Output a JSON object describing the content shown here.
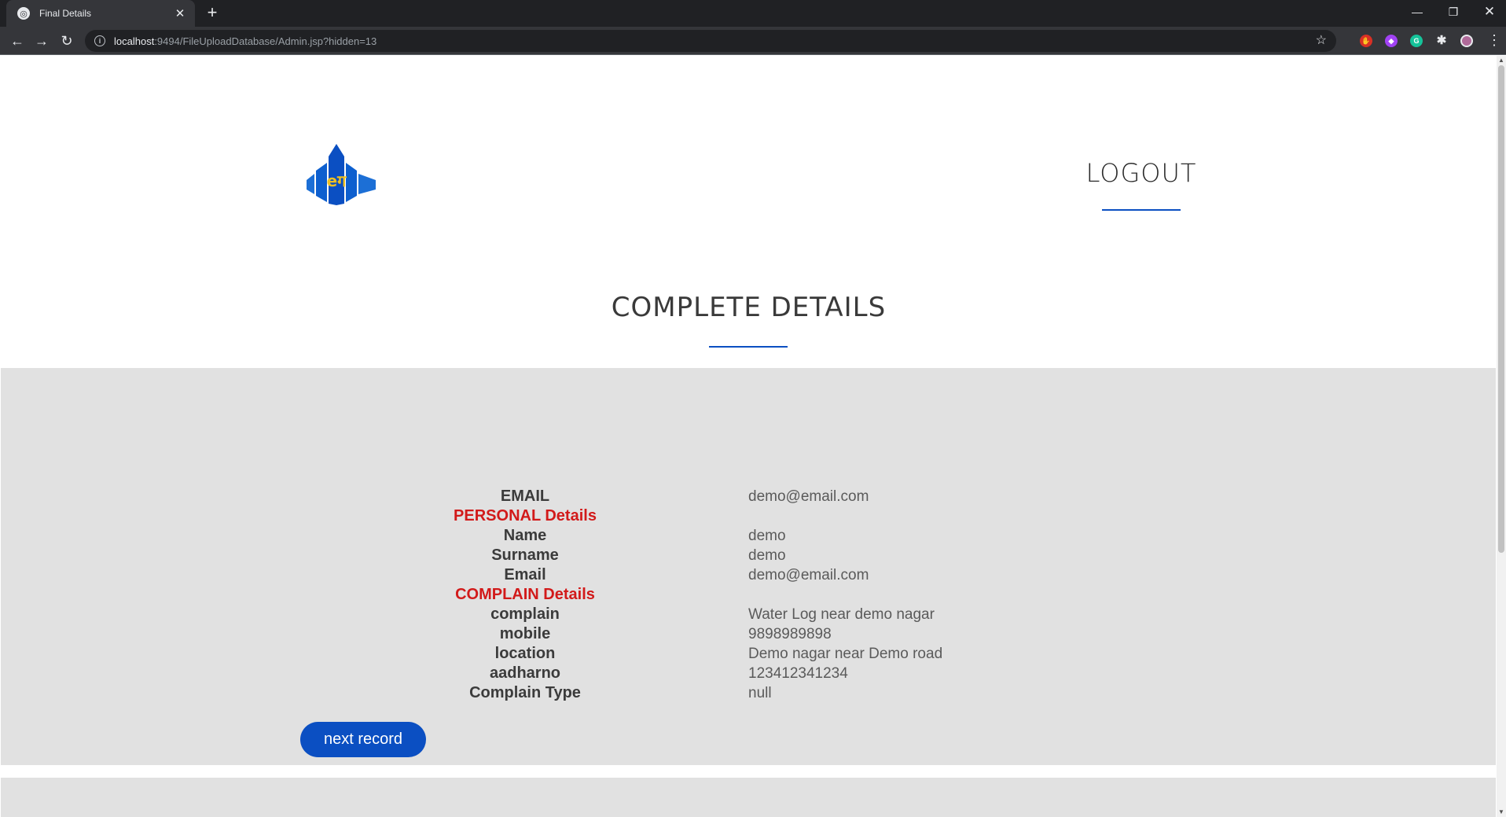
{
  "browser": {
    "tab_title": "Final Details",
    "url_host": "localhost",
    "url_rest": ":9494/FileUploadDatabase/Admin.jsp?hidden=13"
  },
  "header": {
    "logo_text": "eग",
    "logout_label": "LOGOUT"
  },
  "main": {
    "title": "COMPLETE DETAILS",
    "next_button_label": "next record"
  },
  "details": {
    "email_label": "EMAIL",
    "email_value": "demo@email.com",
    "personal_heading": "PERSONAL Details",
    "name_label": "Name",
    "name_value": "demo",
    "surname_label": "Surname",
    "surname_value": "demo",
    "email2_label": "Email",
    "email2_value": "demo@email.com",
    "complain_heading": "COMPLAIN Details",
    "complain_label": "complain",
    "complain_value": "Water Log near demo nagar",
    "mobile_label": "mobile",
    "mobile_value": "9898989898",
    "location_label": "location",
    "location_value": "Demo nagar near Demo road",
    "aadhar_label": "aadharno",
    "aadhar_value": "123412341234",
    "type_label": "Complain Type",
    "type_value": "null"
  },
  "colors": {
    "accent": "#0b4fc2",
    "heading_red": "#d21a1a",
    "panel_bg": "#e1e1e1"
  }
}
